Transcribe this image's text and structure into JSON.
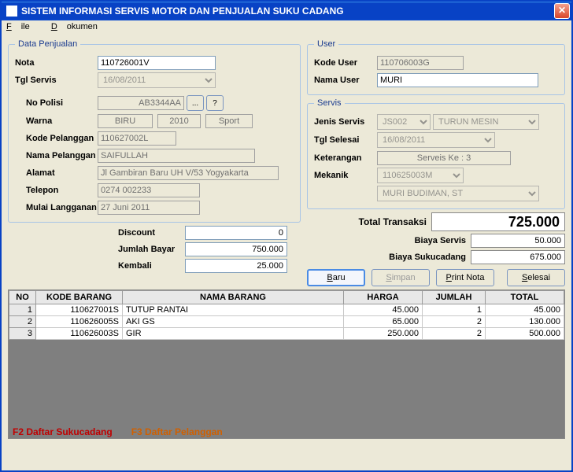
{
  "window": {
    "title": "SISTEM INFORMASI SERVIS MOTOR DAN PENJUALAN SUKU CADANG"
  },
  "menu": {
    "file": "File",
    "dokumen": "Dokumen"
  },
  "penjualan": {
    "legend": "Data Penjualan",
    "nota_label": "Nota",
    "nota": "110726001V",
    "tgl_label": "Tgl Servis",
    "tgl": "16/08/2011",
    "no_polisi_label": "No Polisi",
    "no_polisi": "AB3344AA",
    "btn_dots": "...",
    "btn_q": "?",
    "warna_label": "Warna",
    "warna": "BIRU",
    "tahun": "2010",
    "tipe": "Sport",
    "kode_pel_label": "Kode Pelanggan",
    "kode_pel": "110627002L",
    "nama_pel_label": "Nama Pelanggan",
    "nama_pel": "SAIFULLAH",
    "alamat_label": "Alamat",
    "alamat": "Jl Gambiran Baru UH V/53 Yogyakarta",
    "telepon_label": "Telepon",
    "telepon": "0274 002233",
    "mulai_label": "Mulai Langganan",
    "mulai": "27 Juni 2011"
  },
  "user": {
    "legend": "User",
    "kode_label": "Kode User",
    "kode": "110706003G",
    "nama_label": "Nama User",
    "nama": "MURI"
  },
  "servis": {
    "legend": "Servis",
    "jenis_label": "Jenis Servis",
    "jenis_code": "JS002",
    "jenis_name": "TURUN MESIN",
    "tgl_label": "Tgl Selesai",
    "tgl": "16/08/2011",
    "ket_label": "Keterangan",
    "ket": "Serveis Ke : 3",
    "mekanik_label": "Mekanik",
    "mekanik_code": "110625003M",
    "mekanik_name": "MURI BUDIMAN, ST"
  },
  "totals": {
    "total_label": "Total Transaksi",
    "total": "725.000",
    "biaya_servis_label": "Biaya Servis",
    "biaya_servis": "50.000",
    "biaya_suku_label": "Biaya Sukucadang",
    "biaya_suku": "675.000"
  },
  "disc": {
    "discount_label": "Discount",
    "discount": "0",
    "jumlah_bayar_label": "Jumlah Bayar",
    "jumlah_bayar": "750.000",
    "kembali_label": "Kembali",
    "kembali": "25.000"
  },
  "buttons": {
    "baru": "Baru",
    "simpan": "Simpan",
    "print": "Print Nota",
    "selesai": "Selesai"
  },
  "grid": {
    "headers": {
      "no": "NO",
      "kode": "KODE BARANG",
      "nama": "NAMA BARANG",
      "harga": "HARGA",
      "jumlah": "JUMLAH",
      "total": "TOTAL"
    },
    "rows": [
      {
        "no": "1",
        "kode": "110627001S",
        "nama": "TUTUP RANTAI",
        "harga": "45.000",
        "jumlah": "1",
        "total": "45.000"
      },
      {
        "no": "2",
        "kode": "110626005S",
        "nama": "AKI GS",
        "harga": "65.000",
        "jumlah": "2",
        "total": "130.000"
      },
      {
        "no": "3",
        "kode": "110626003S",
        "nama": "GIR",
        "harga": "250.000",
        "jumlah": "2",
        "total": "500.000"
      }
    ]
  },
  "hints": {
    "f2": "F2 Daftar Sukucadang",
    "f3": "F3 Daftar Pelanggan"
  }
}
